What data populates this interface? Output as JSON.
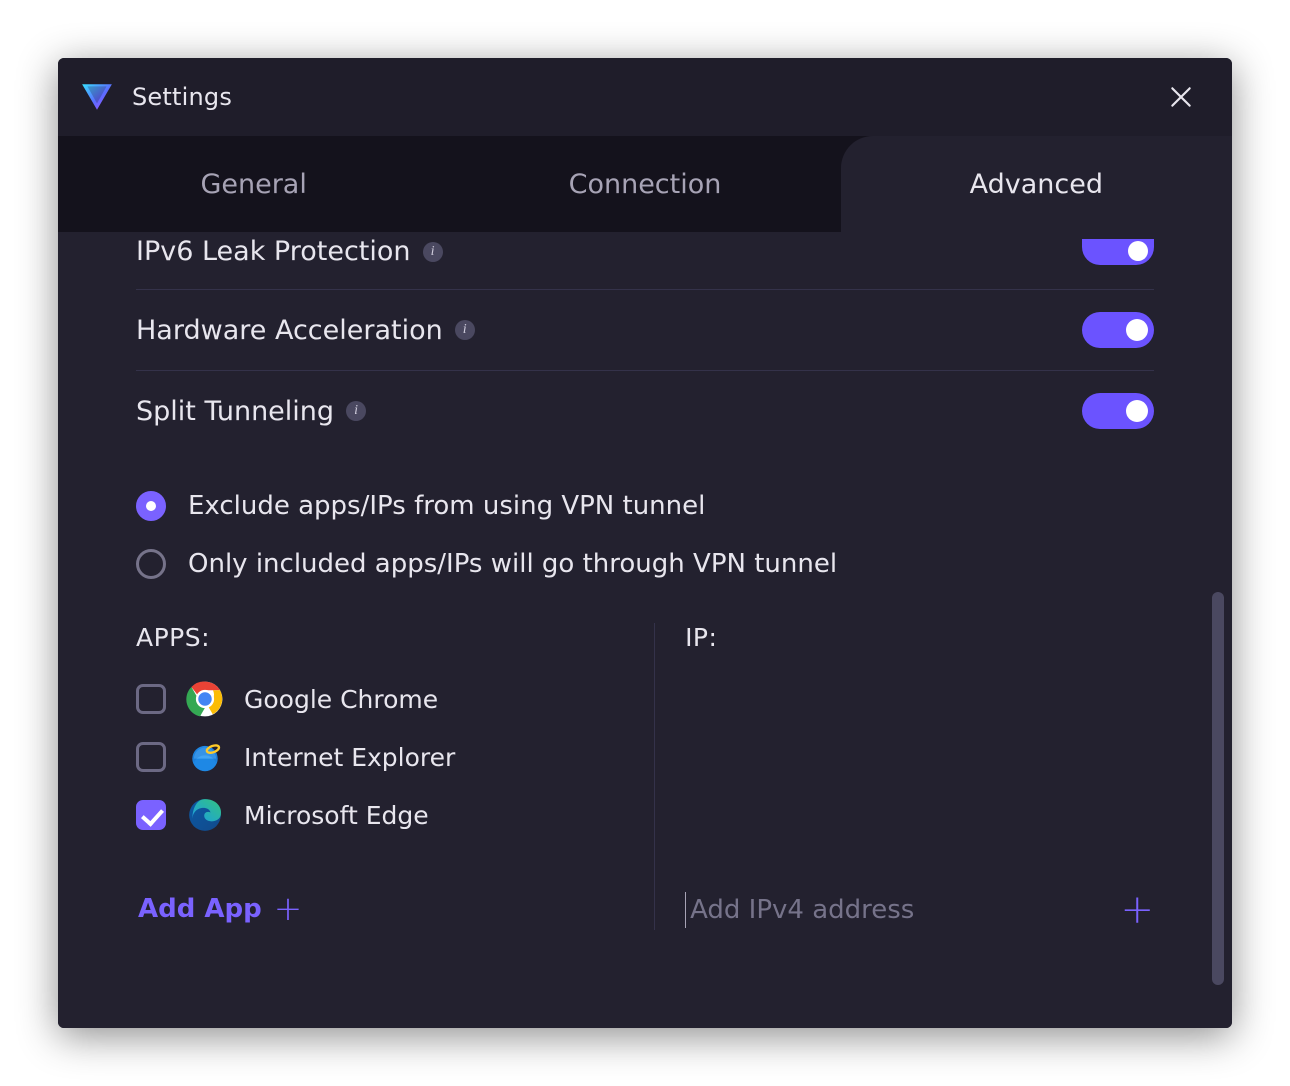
{
  "window": {
    "title": "Settings"
  },
  "tabs": [
    {
      "id": "general",
      "label": "General",
      "active": false
    },
    {
      "id": "connection",
      "label": "Connection",
      "active": false
    },
    {
      "id": "advanced",
      "label": "Advanced",
      "active": true
    }
  ],
  "settings": {
    "ipv6": {
      "label": "IPv6 Leak Protection",
      "enabled": true
    },
    "hwaccel": {
      "label": "Hardware Acceleration",
      "enabled": true
    },
    "splittun": {
      "label": "Split Tunneling",
      "enabled": true
    }
  },
  "split_mode": {
    "options": [
      {
        "id": "exclude",
        "label": "Exclude apps/IPs from using VPN tunnel",
        "selected": true
      },
      {
        "id": "include",
        "label": "Only included apps/IPs will go through VPN tunnel",
        "selected": false
      }
    ]
  },
  "apps_section": {
    "title": "APPS:",
    "add_label": "Add App",
    "items": [
      {
        "name": "Google Chrome",
        "icon": "chrome-icon",
        "checked": false
      },
      {
        "name": "Internet Explorer",
        "icon": "ie-icon",
        "checked": false
      },
      {
        "name": "Microsoft Edge",
        "icon": "edge-icon",
        "checked": true
      }
    ]
  },
  "ip_section": {
    "title": "IP:",
    "placeholder": "Add IPv4 address"
  },
  "icons": {
    "info_glyph": "i",
    "plus_glyph": "+"
  }
}
